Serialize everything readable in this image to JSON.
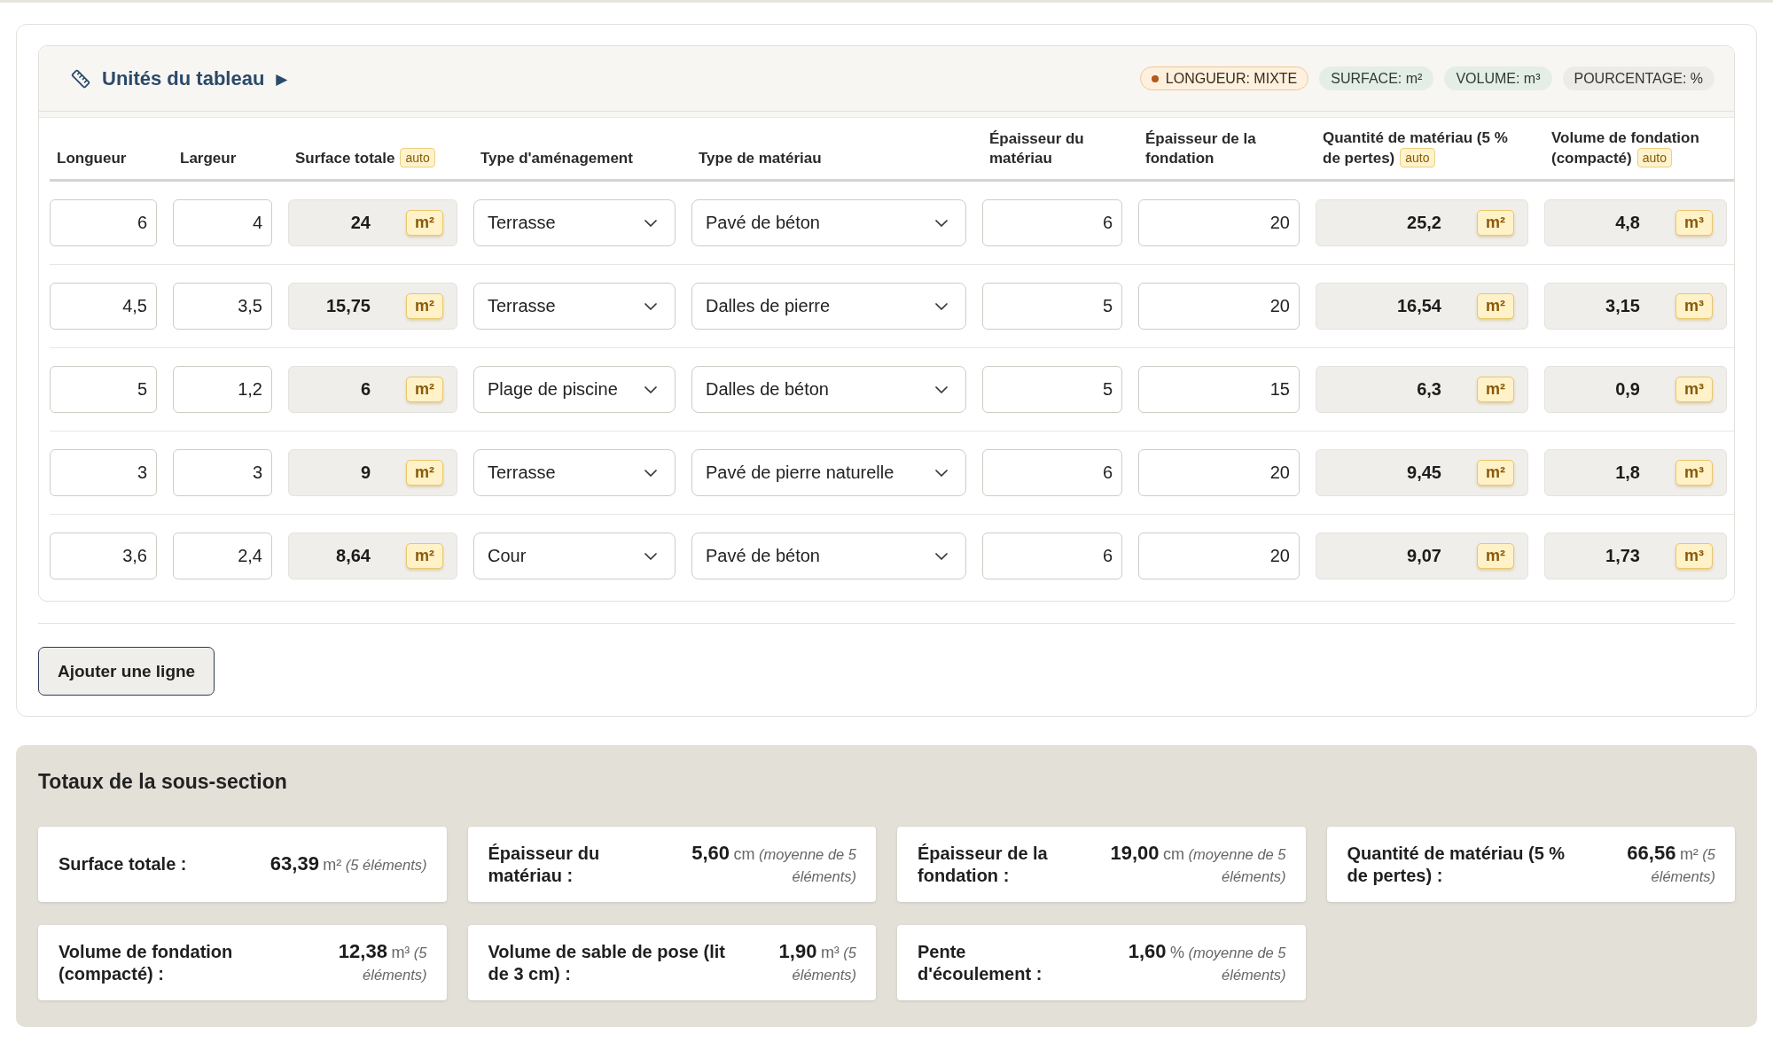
{
  "units_panel": {
    "title": "Unités du tableau",
    "toggle": "▶",
    "badges": [
      {
        "label": "LONGUEUR: MIXTE",
        "kind": "warning"
      },
      {
        "label": "SURFACE: m²",
        "kind": "unit"
      },
      {
        "label": "VOLUME: m³",
        "kind": "unit"
      },
      {
        "label": "POURCENTAGE: %",
        "kind": "neutral"
      }
    ]
  },
  "table": {
    "columns": [
      {
        "label": "Longueur"
      },
      {
        "label": "Largeur"
      },
      {
        "label": "Surface totale",
        "tag": "auto"
      },
      {
        "label": "Type d'aménagement"
      },
      {
        "label": "Type de matériau"
      },
      {
        "label": "Épaisseur du matériau"
      },
      {
        "label": "Épaisseur de la fondation"
      },
      {
        "label": "Quantité de matériau (5 % de pertes)",
        "tag": "auto"
      },
      {
        "label": "Volume de fondation (compacté)",
        "tag": "auto"
      }
    ],
    "rows": [
      {
        "cells": [
          {
            "kind": "input",
            "value": "6"
          },
          {
            "kind": "input",
            "value": "4"
          },
          {
            "kind": "computed",
            "value": "24",
            "unit": "m²"
          },
          {
            "kind": "select",
            "value": "Terrasse"
          },
          {
            "kind": "select",
            "value": "Pavé de béton"
          },
          {
            "kind": "input",
            "value": "6"
          },
          {
            "kind": "input",
            "value": "20"
          },
          {
            "kind": "computed",
            "value": "25,2",
            "unit": "m²"
          },
          {
            "kind": "computed",
            "value": "4,8",
            "unit": "m³"
          }
        ]
      },
      {
        "cells": [
          {
            "kind": "input",
            "value": "4,5"
          },
          {
            "kind": "input",
            "value": "3,5"
          },
          {
            "kind": "computed",
            "value": "15,75",
            "unit": "m²"
          },
          {
            "kind": "select",
            "value": "Terrasse"
          },
          {
            "kind": "select",
            "value": "Dalles de pierre"
          },
          {
            "kind": "input",
            "value": "5"
          },
          {
            "kind": "input",
            "value": "20"
          },
          {
            "kind": "computed",
            "value": "16,54",
            "unit": "m²"
          },
          {
            "kind": "computed",
            "value": "3,15",
            "unit": "m³"
          }
        ]
      },
      {
        "cells": [
          {
            "kind": "input",
            "value": "5"
          },
          {
            "kind": "input",
            "value": "1,2"
          },
          {
            "kind": "computed",
            "value": "6",
            "unit": "m²"
          },
          {
            "kind": "select",
            "value": "Plage de piscine"
          },
          {
            "kind": "select",
            "value": "Dalles de béton"
          },
          {
            "kind": "input",
            "value": "5"
          },
          {
            "kind": "input",
            "value": "15"
          },
          {
            "kind": "computed",
            "value": "6,3",
            "unit": "m²"
          },
          {
            "kind": "computed",
            "value": "0,9",
            "unit": "m³"
          }
        ]
      },
      {
        "cells": [
          {
            "kind": "input",
            "value": "3"
          },
          {
            "kind": "input",
            "value": "3"
          },
          {
            "kind": "computed",
            "value": "9",
            "unit": "m²"
          },
          {
            "kind": "select",
            "value": "Terrasse"
          },
          {
            "kind": "select",
            "value": "Pavé de pierre naturelle"
          },
          {
            "kind": "input",
            "value": "6"
          },
          {
            "kind": "input",
            "value": "20"
          },
          {
            "kind": "computed",
            "value": "9,45",
            "unit": "m²"
          },
          {
            "kind": "computed",
            "value": "1,8",
            "unit": "m³"
          }
        ]
      },
      {
        "cells": [
          {
            "kind": "input",
            "value": "3,6"
          },
          {
            "kind": "input",
            "value": "2,4"
          },
          {
            "kind": "computed",
            "value": "8,64",
            "unit": "m²"
          },
          {
            "kind": "select",
            "value": "Cour"
          },
          {
            "kind": "select",
            "value": "Pavé de béton"
          },
          {
            "kind": "input",
            "value": "6"
          },
          {
            "kind": "input",
            "value": "20"
          },
          {
            "kind": "computed",
            "value": "9,07",
            "unit": "m²"
          },
          {
            "kind": "computed",
            "value": "1,73",
            "unit": "m³"
          }
        ]
      }
    ]
  },
  "add_button": "Ajouter une ligne",
  "totals": {
    "title": "Totaux de la sous-section",
    "items": [
      {
        "label": "Surface totale :",
        "value": "63,39",
        "unit": "m²",
        "note": "(5 éléments)"
      },
      {
        "label": "Épaisseur du matériau :",
        "value": "5,60",
        "unit": "cm",
        "note": "(moyenne de 5 éléments)"
      },
      {
        "label": "Épaisseur de la fondation :",
        "value": "19,00",
        "unit": "cm",
        "note": "(moyenne de 5 éléments)"
      },
      {
        "label": "Quantité de matériau (5 % de pertes) :",
        "value": "66,56",
        "unit": "m²",
        "note": "(5 éléments)"
      },
      {
        "label": "Volume de fondation (compacté) :",
        "value": "12,38",
        "unit": "m³",
        "note": "(5 éléments)"
      },
      {
        "label": "Volume de sable de pose (lit de 3 cm) :",
        "value": "1,90",
        "unit": "m³",
        "note": "(5 éléments)"
      },
      {
        "label": "Pente d'écoulement :",
        "value": "1,60",
        "unit": "%",
        "note": "(moyenne de 5 éléments)"
      }
    ]
  }
}
